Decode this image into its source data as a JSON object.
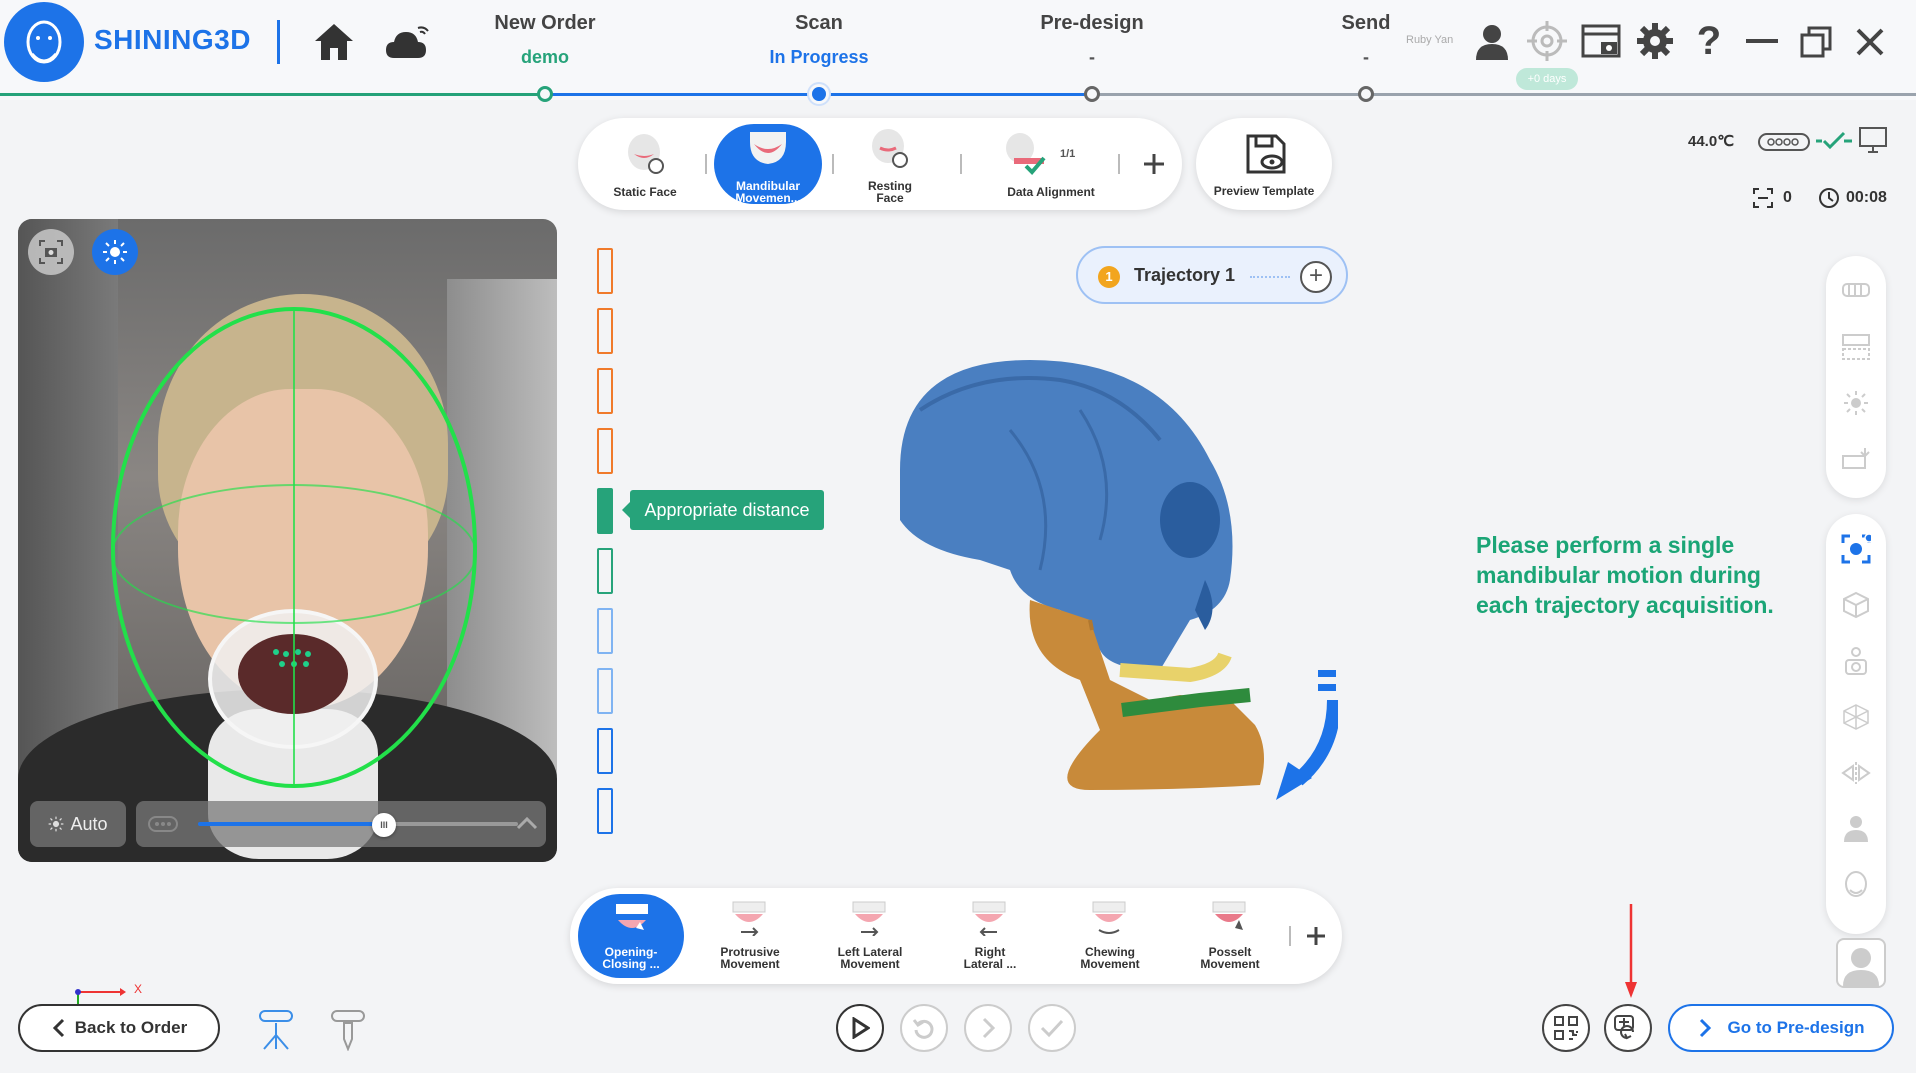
{
  "brand": {
    "name": "SHINING3D"
  },
  "workflow": {
    "steps": [
      {
        "title": "New Order",
        "status": "demo"
      },
      {
        "title": "Scan",
        "status": "In Progress"
      },
      {
        "title": "Pre-design",
        "status": "-"
      },
      {
        "title": "Send",
        "status": "-"
      }
    ]
  },
  "user": {
    "name": "Ruby Yan",
    "badge": "+0 days"
  },
  "scan_modes": [
    {
      "label": "Static Face",
      "active": false
    },
    {
      "label": "Mandibular Movemen...",
      "active": true
    },
    {
      "label": "Resting Face",
      "active": false
    },
    {
      "label": "Data Alignment",
      "counter": "1/1",
      "active": false
    }
  ],
  "preview_template": {
    "label": "Preview Template"
  },
  "device": {
    "temperature": "44.0℃",
    "count": "0",
    "timer": "00:08"
  },
  "camera": {
    "auto_label": "Auto",
    "exposure_level": 0.58
  },
  "distance_tip": "Appropriate distance",
  "trajectory": {
    "number": "1",
    "label": "Trajectory 1"
  },
  "instruction": "Please perform a single mandibular motion during each trajectory acquisition.",
  "motions": [
    {
      "label": "Opening-Closing ...",
      "active": true
    },
    {
      "label": "Protrusive Movement",
      "active": false
    },
    {
      "label": "Left Lateral Movement",
      "active": false
    },
    {
      "label": "Right Lateral ...",
      "active": false
    },
    {
      "label": "Chewing Movement",
      "active": false
    },
    {
      "label": "Posselt Movement",
      "active": false
    }
  ],
  "axes": {
    "x_label": "X"
  },
  "buttons": {
    "back": "Back to Order",
    "go_next": "Go to Pre-design"
  },
  "colors": {
    "accent": "#1d73e8",
    "success": "#26a37a",
    "warning": "#f07a2a",
    "instruction": "#1ba576"
  }
}
